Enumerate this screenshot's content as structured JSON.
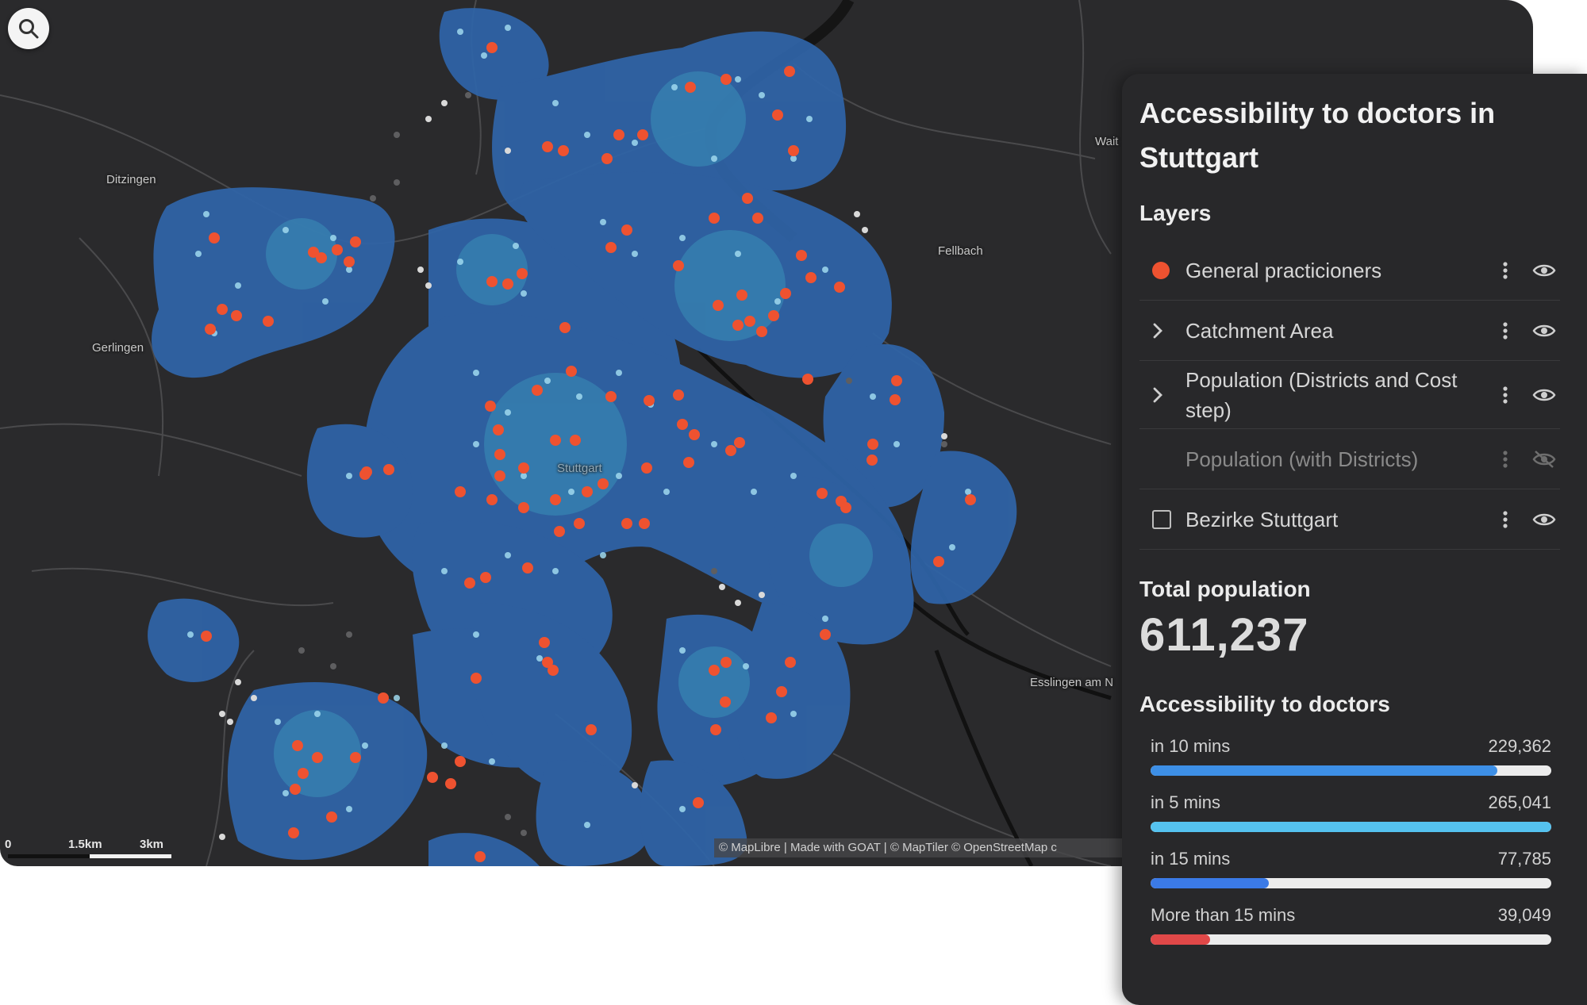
{
  "map": {
    "search_icon": "search-icon",
    "places": {
      "ditzingen": "Ditzingen",
      "gerlingen": "Gerlingen",
      "fellbach": "Fellbach",
      "waiblingen": "Wait",
      "stuttgart": "Stuttgart",
      "esslingen": "Esslingen am N"
    },
    "scale": {
      "zero": "0",
      "mid": "1.5km",
      "end": "3km"
    },
    "attribution": "© MapLibre | Made with GOAT | © MapTiler © OpenStreetMap c"
  },
  "panel": {
    "title": "Accessibility to doctors in Stuttgart",
    "layers_heading": "Layers",
    "layers": [
      {
        "label": "General practicioners",
        "lead": "orange-dot",
        "visible": true
      },
      {
        "label": "Catchment Area",
        "lead": "chevron-right-icon",
        "visible": true
      },
      {
        "label": "Population (Districts and Cost step)",
        "lead": "chevron-right-icon",
        "visible": true
      },
      {
        "label": "Population (with Districts)",
        "lead": "none",
        "visible": false
      },
      {
        "label": "Bezirke Stuttgart",
        "lead": "checkbox",
        "visible": true
      }
    ],
    "total_population_heading": "Total population",
    "total_population_value": "611,237",
    "accessibility_heading": "Accessibility to doctors",
    "accessibility": [
      {
        "label": "in 10 mins",
        "value": "229,362",
        "fraction": 0.865,
        "color": "#3d8fe6"
      },
      {
        "label": "in 5 mins",
        "value": "265,041",
        "fraction": 1.0,
        "color": "#55c2ef"
      },
      {
        "label": "in 15 mins",
        "value": "77,785",
        "fraction": 0.295,
        "color": "#3b7ae6"
      },
      {
        "label": "More than 15 mins",
        "value": "39,049",
        "fraction": 0.148,
        "color": "#e04848"
      }
    ]
  },
  "colors": {
    "map_background": "#2a2a2c",
    "catchment_blue": "#2f64a8",
    "doctor_orange": "#ee5230",
    "population_dot": "#9fd9ee",
    "panel_background": "#28282a"
  }
}
